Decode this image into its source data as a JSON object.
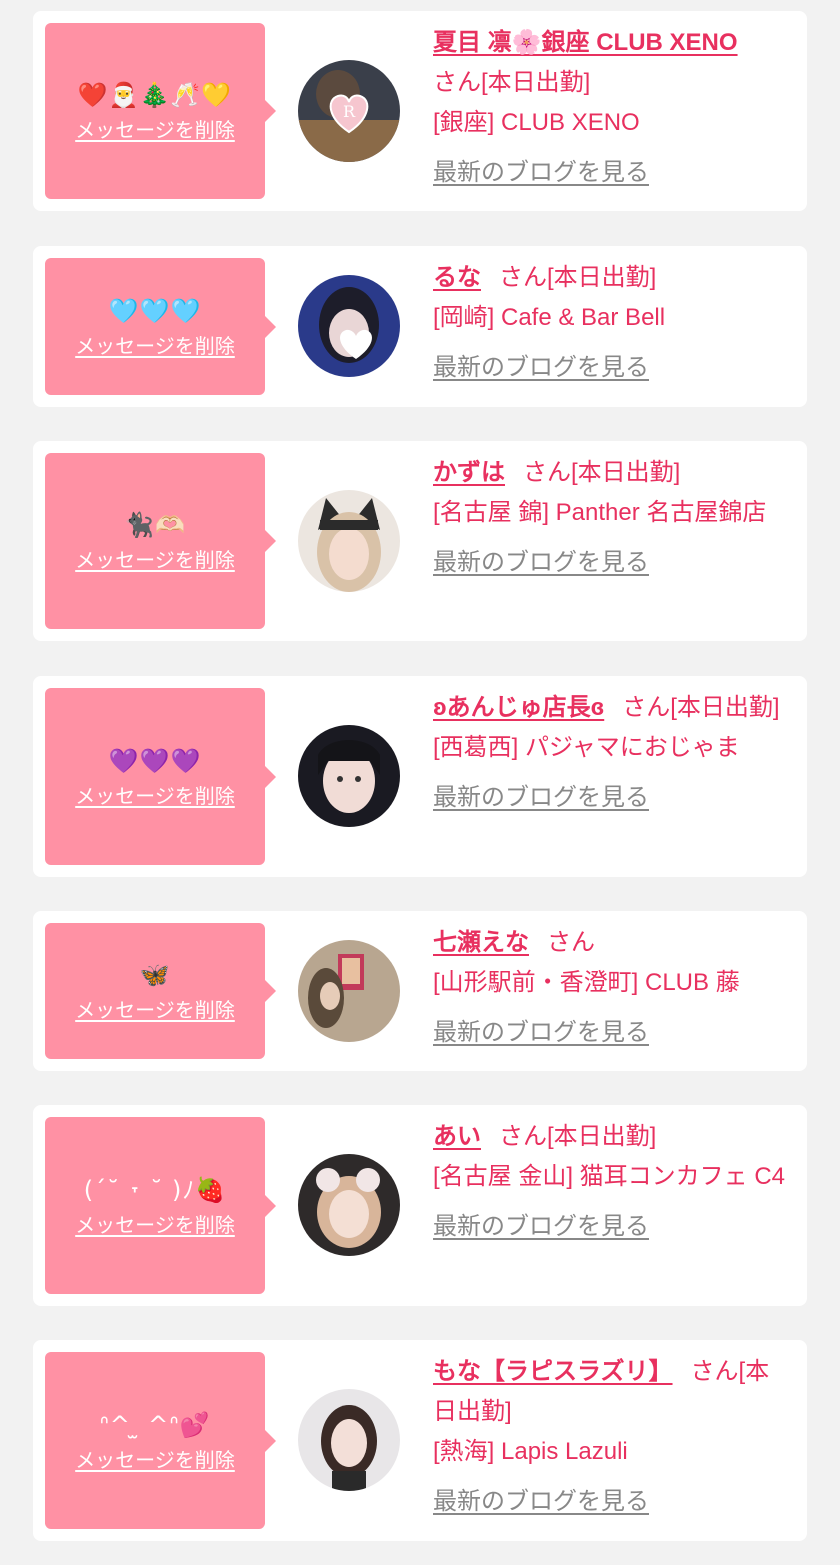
{
  "messages": [
    {
      "message_text": "❤️🎅🎄🥂💛",
      "delete_label": "メッセージを削除",
      "cast_name": "夏目 凛🌸銀座 CLUB XENO",
      "suffix": "さん[本日出勤]",
      "shop": "[銀座] CLUB XENO",
      "blog_label": "最新のブログを見る"
    },
    {
      "message_text": "🩵🩵🩵",
      "delete_label": "メッセージを削除",
      "cast_name": "るな",
      "suffix": "さん[本日出勤]",
      "shop": "[岡崎] Cafe & Bar Bell",
      "blog_label": "最新のブログを見る"
    },
    {
      "message_text": "🐈‍⬛🫶🏻",
      "delete_label": "メッセージを削除",
      "cast_name": "かずは",
      "suffix": "さん[本日出勤]",
      "shop": "[名古屋 錦] Panther 名古屋錦店",
      "blog_label": "最新のブログを見る"
    },
    {
      "message_text": "💜💜💜",
      "delete_label": "メッセージを削除",
      "cast_name": "ʚあんじゅ店長ɞ",
      "suffix": "さん[本日出勤]",
      "shop": "[西葛西] パジャマにおじゃま",
      "blog_label": "最新のブログを見る"
    },
    {
      "message_text": "🦋",
      "delete_label": "メッセージを削除",
      "cast_name": "七瀬えな",
      "suffix": "さん",
      "shop": "[山形駅前・香澄町] CLUB 藤",
      "blog_label": "最新のブログを見る"
    },
    {
      "message_text": "(ˊ˘ ˕ ˘ )ﾉ🍓",
      "delete_label": "メッセージを削除",
      "cast_name": "あい",
      "suffix": "さん[本日出勤]",
      "shop": "[名古屋 金山] 猫耳コンカフェ C4",
      "blog_label": "最新のブログを見る"
    },
    {
      "message_text": "ᐢ^ ̫ ^ᐢ💕",
      "delete_label": "メッセージを削除",
      "cast_name": "もな【ラピスラズリ】",
      "suffix": "さん[本日出勤]",
      "shop": "[熱海] Lapis Lazuli",
      "blog_label": "最新のブログを見る"
    }
  ],
  "colors": {
    "page_background": "#f2f2f2",
    "card_background": "#ffffff",
    "message_box": "#ff91a4",
    "accent_text": "#e8305f",
    "muted_link": "#888888"
  }
}
